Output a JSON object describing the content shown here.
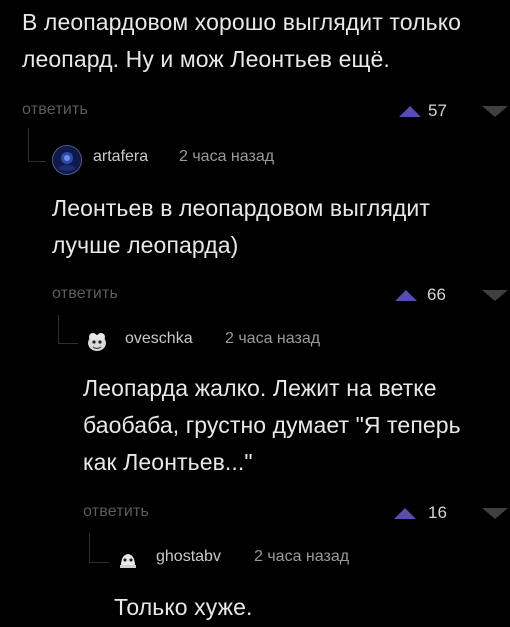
{
  "colors": {
    "background": "#000000",
    "text": "#e8e8e8",
    "reply_link": "#5c5c62",
    "upvote": "#5a4db0",
    "downvote": "#3f3f44",
    "thread_line": "#2e2e33"
  },
  "icons": {
    "upvote": "triangle-up-icon",
    "downvote": "triangle-down-icon"
  },
  "comments": [
    {
      "text": "В леопардовом хорошо выглядит только\nлеопард. Ну и мож Леонтьев ещё.",
      "reply_label": "ответить",
      "score": "57"
    },
    {
      "author": "artafera",
      "time": "2 часа назад",
      "text": "Леонтьев в леопардовом выглядит\nлучше леопарда)",
      "reply_label": "ответить",
      "score": "66"
    },
    {
      "author": "oveschka",
      "time": "2 часа назад",
      "text": "Леопарда жалко. Лежит на ветке\nбаобаба, грустно думает \"Я теперь\nкак Леонтьев...\"",
      "reply_label": "ответить",
      "score": "16"
    },
    {
      "author": "ghostabv",
      "time": "2 часа назад",
      "text": "Только хуже."
    }
  ]
}
